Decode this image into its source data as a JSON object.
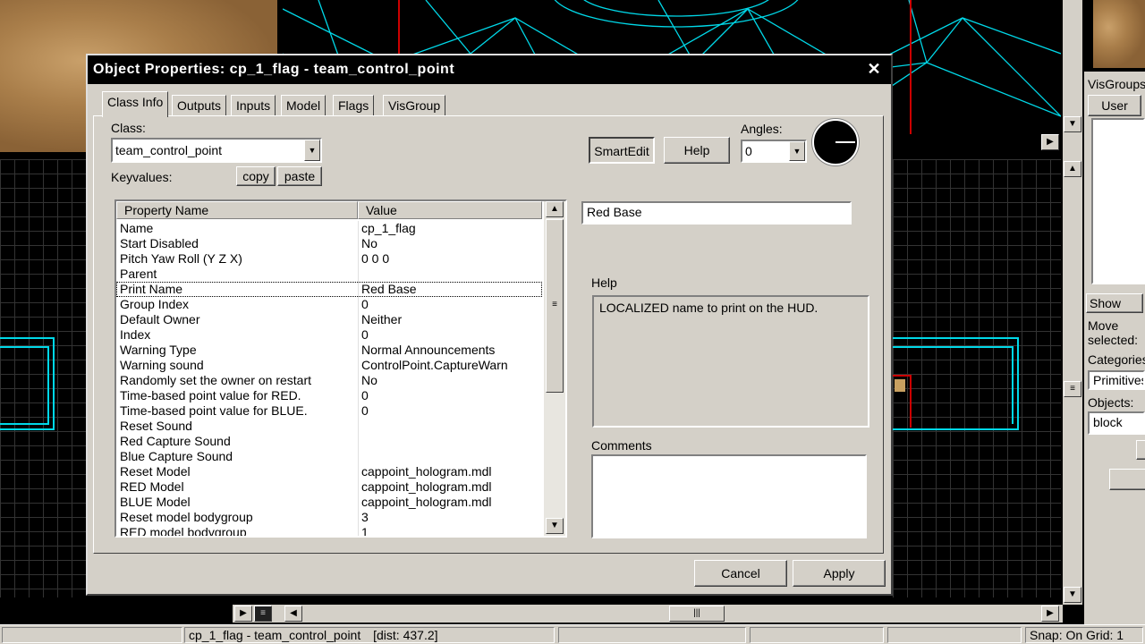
{
  "dialog": {
    "title": "Object Properties: cp_1_flag - team_control_point",
    "close_glyph": "✕",
    "tabs": [
      "Class Info",
      "Outputs",
      "Inputs",
      "Model",
      "Flags",
      "VisGroup"
    ],
    "class_label": "Class:",
    "class_value": "team_control_point",
    "keyvalues_label": "Keyvalues:",
    "copy_label": "copy",
    "paste_label": "paste",
    "smartedit_label": "SmartEdit",
    "help_button_label": "Help",
    "angles_label": "Angles:",
    "angles_value": "0",
    "value_edit": "Red Base",
    "help_section_label": "Help",
    "help_text": "LOCALIZED name to print on the HUD.",
    "comments_label": "Comments",
    "comments_value": "",
    "cancel_label": "Cancel",
    "apply_label": "Apply",
    "grid": {
      "col_property": "Property Name",
      "col_value": "Value",
      "selected_index": 4,
      "rows": [
        {
          "k": "Name",
          "v": "cp_1_flag"
        },
        {
          "k": "Start Disabled",
          "v": "No"
        },
        {
          "k": "Pitch Yaw Roll (Y Z X)",
          "v": "0 0 0"
        },
        {
          "k": "Parent",
          "v": ""
        },
        {
          "k": "Print Name",
          "v": "Red Base"
        },
        {
          "k": "Group Index",
          "v": "0"
        },
        {
          "k": "Default Owner",
          "v": "Neither"
        },
        {
          "k": "Index",
          "v": "0"
        },
        {
          "k": "Warning Type",
          "v": "Normal Announcements"
        },
        {
          "k": "Warning sound",
          "v": "ControlPoint.CaptureWarn"
        },
        {
          "k": "Randomly set the owner on restart",
          "v": "No"
        },
        {
          "k": "Time-based point value for RED.",
          "v": "0"
        },
        {
          "k": "Time-based point value for BLUE.",
          "v": "0"
        },
        {
          "k": "Reset Sound",
          "v": ""
        },
        {
          "k": "Red Capture Sound",
          "v": ""
        },
        {
          "k": "Blue Capture Sound",
          "v": ""
        },
        {
          "k": "Reset Model",
          "v": "cappoint_hologram.mdl"
        },
        {
          "k": "RED Model",
          "v": "cappoint_hologram.mdl"
        },
        {
          "k": "BLUE Model",
          "v": "cappoint_hologram.mdl"
        },
        {
          "k": "Reset model bodygroup",
          "v": "3"
        },
        {
          "k": "RED model bodygroup",
          "v": "1"
        }
      ]
    }
  },
  "right_panel": {
    "visgroups_label": "VisGroups",
    "user_tab": "User",
    "show_label": "Show",
    "move_selected_label": "Move selected:",
    "categories_label": "Categories",
    "categories_value": "Primitives",
    "objects_label": "Objects:",
    "objects_value": "block"
  },
  "status_bar": {
    "selection": "cp_1_flag - team_control_point",
    "distance": "[dist: 437.2]",
    "snap": "Snap: On Grid: 1"
  }
}
